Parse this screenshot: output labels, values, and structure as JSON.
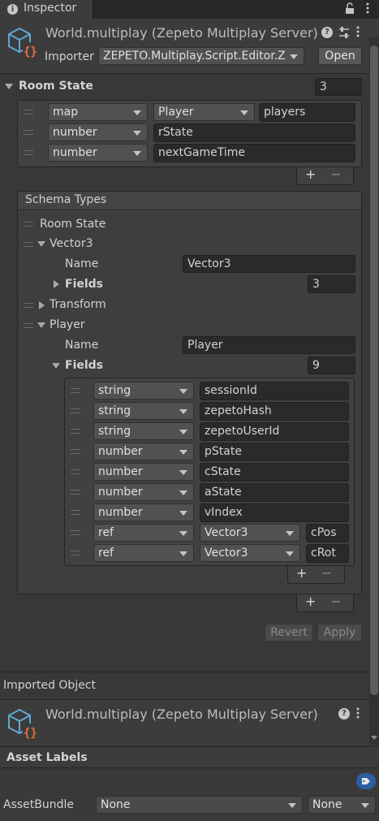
{
  "tab": {
    "title": "Inspector"
  },
  "header": {
    "title": "World.multiplay (Zepeto Multiplay Server)",
    "importer_label": "Importer",
    "importer_value": "ZEPETO.Multiplay.Script.Editor.Z",
    "open_button": "Open"
  },
  "room_state": {
    "label": "Room State",
    "count": "3",
    "rows": [
      {
        "type": "map",
        "subtype": "Player",
        "name": "players"
      },
      {
        "type": "number",
        "name": "rState"
      },
      {
        "type": "number",
        "name": "nextGameTime"
      }
    ],
    "plus": "+",
    "minus": "−"
  },
  "schema": {
    "title": "Schema Types",
    "items": [
      {
        "label": "Room State"
      },
      {
        "label": "Vector3",
        "name_label": "Name",
        "name_value": "Vector3",
        "fields_label": "Fields",
        "fields_count": "3"
      },
      {
        "label": "Transform"
      },
      {
        "label": "Player",
        "name_label": "Name",
        "name_value": "Player",
        "fields_label": "Fields",
        "fields_count": "9"
      }
    ],
    "player_fields": [
      {
        "type": "string",
        "name": "sessionId"
      },
      {
        "type": "string",
        "name": "zepetoHash"
      },
      {
        "type": "string",
        "name": "zepetoUserId"
      },
      {
        "type": "number",
        "name": "pState"
      },
      {
        "type": "number",
        "name": "cState"
      },
      {
        "type": "number",
        "name": "aState"
      },
      {
        "type": "number",
        "name": "vIndex"
      },
      {
        "type": "ref",
        "subtype": "Vector3",
        "name": "cPos"
      },
      {
        "type": "ref",
        "subtype": "Vector3",
        "name": "cRot"
      }
    ],
    "plus": "+",
    "minus": "−"
  },
  "actions": {
    "revert": "Revert",
    "apply": "Apply"
  },
  "imported": {
    "section_label": "Imported Object",
    "title": "World.multiplay (Zepeto Multiplay Server)"
  },
  "asset_labels": {
    "label": "Asset Labels",
    "bundle_label": "AssetBundle",
    "bundle_value": "None",
    "variant_value": "None"
  },
  "colors": {
    "accent_icon": "#5fa8d3",
    "script_brace": "#e8743b",
    "tag_icon": "#2b5fa0"
  }
}
